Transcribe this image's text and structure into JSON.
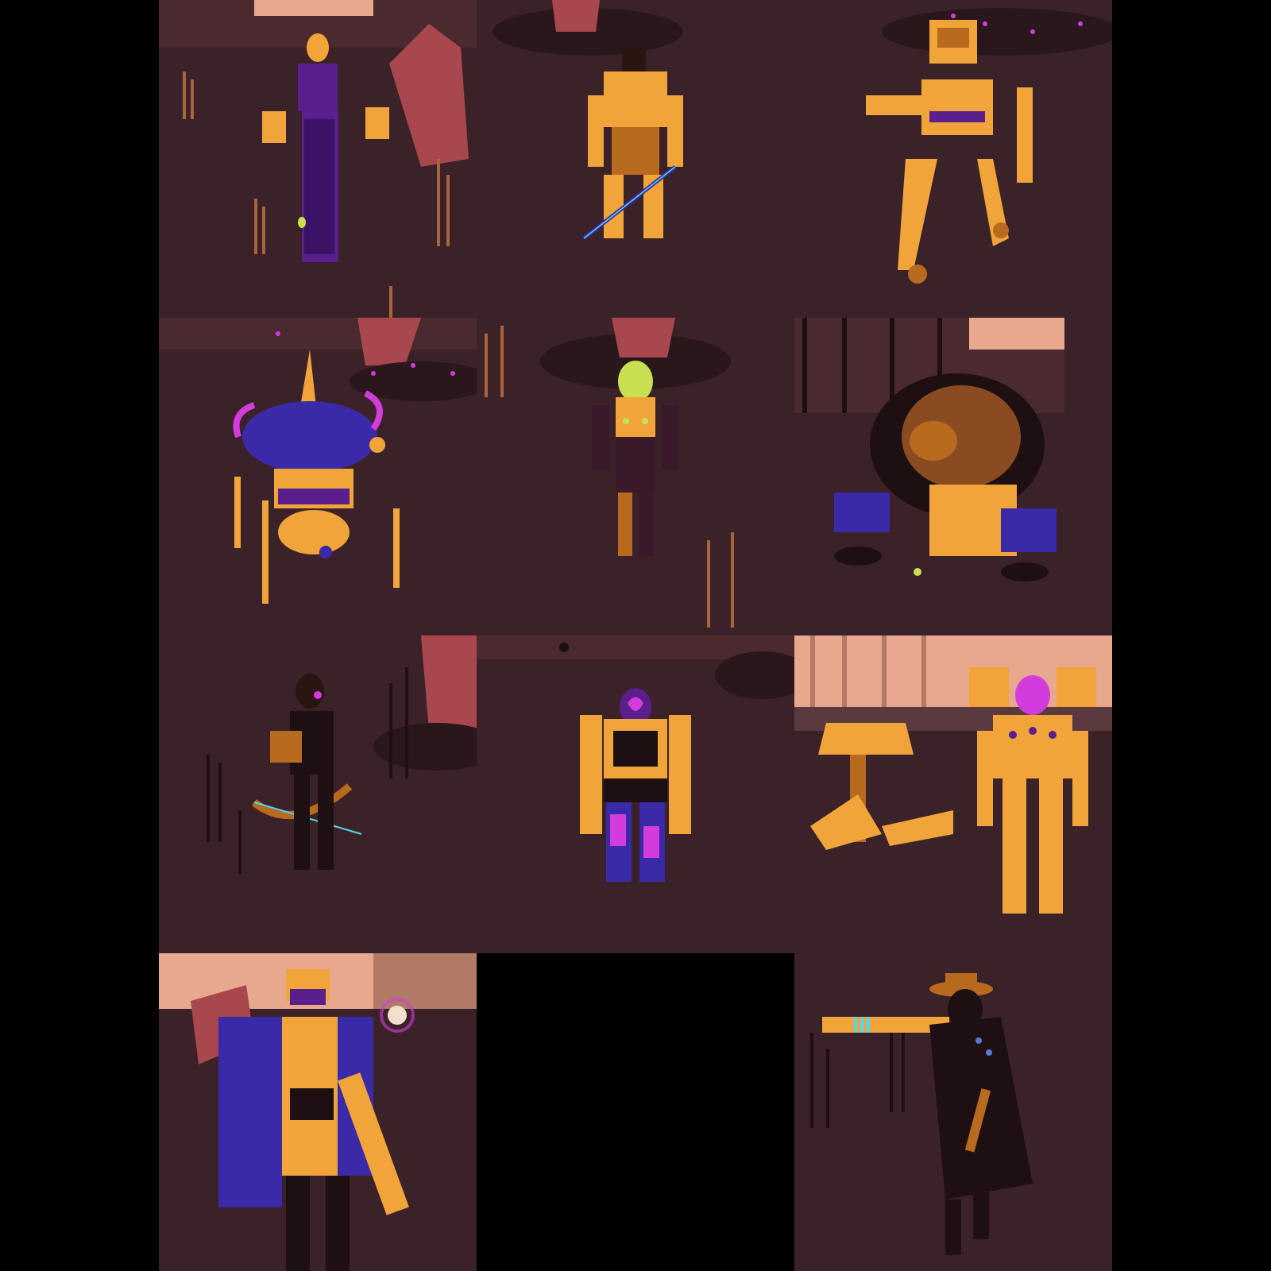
{
  "grid": {
    "columns": 3,
    "rows": 4,
    "cells": [
      {
        "id": 1,
        "subject": "robed-figure",
        "filled": true
      },
      {
        "id": 2,
        "subject": "armored-swordsman",
        "filled": true
      },
      {
        "id": 3,
        "subject": "walker-mech",
        "filled": true
      },
      {
        "id": 4,
        "subject": "plant-pod-walker",
        "filled": true
      },
      {
        "id": 5,
        "subject": "green-visor-suit",
        "filled": true
      },
      {
        "id": 6,
        "subject": "hunched-brute",
        "filled": true
      },
      {
        "id": 7,
        "subject": "archer",
        "filled": true
      },
      {
        "id": 8,
        "subject": "armored-heart-figure",
        "filled": true
      },
      {
        "id": 9,
        "subject": "turret-and-mech-soldier",
        "filled": true
      },
      {
        "id": 10,
        "subject": "coat-gunner",
        "filled": true
      },
      {
        "id": 11,
        "subject": "",
        "filled": false
      },
      {
        "id": 12,
        "subject": "cowboy-gunslinger",
        "filled": true
      }
    ]
  },
  "colors": {
    "ground": "#3b2228",
    "ground_dark": "#2a171c",
    "sky": "#e8a88e",
    "orange": "#f0a43a",
    "orange_dark": "#b86a1e",
    "purple": "#5a1f8c",
    "magenta": "#d23cdc",
    "blue": "#3a2aa8",
    "grass": "#a8643c",
    "rock": "#a8484e",
    "silhouette": "#1e1012",
    "lime": "#c8e050",
    "cyan": "#50d8f0",
    "empty": "#000000"
  }
}
